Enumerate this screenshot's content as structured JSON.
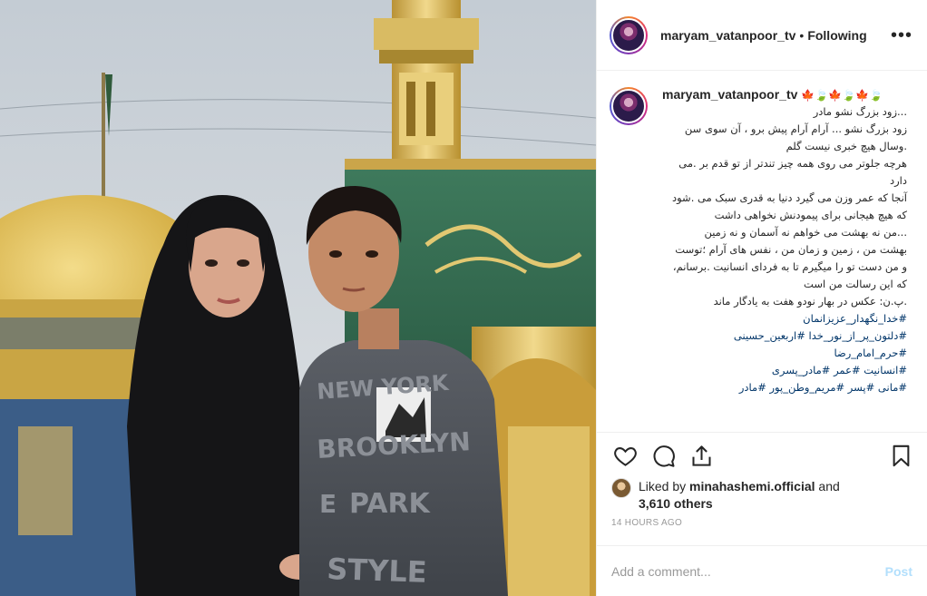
{
  "post": {
    "username": "maryam_vatanpoor_tv",
    "separator": "•",
    "follow_status": "Following",
    "more_glyph": "•••",
    "caption": {
      "username": "maryam_vatanpoor_tv",
      "emoji": "🍁🍃🍁🍃🍁🍃",
      "text": "...زود بزرگ نشو مادر\nزود بزرگ نشو ... آرام آرام پیش برو ، آن سوی سن .وسال هیچ خبری نیست گلم\nهرچه جلوتر می روی همه چیز تندتر از تو قدم بر .می دارد\nآنجا که عمر وزن می گیرد دنیا به قدری سبک می .شود که هیچ هیجانی برای پیمودنش نخواهی داشت\n...من نه بهشت می خواهم نه آسمان و نه زمین\nبهشت من ، زمین و زمان من ، نفس های آرام ؛توست\nو من دست تو را میگیرم تا به فردای انسانیت .برسانم، که این رسالت من است\n.پ.ن: عکس در بهار نودو هفت به یادگار ماند",
      "hashtags": [
        "#خدا_نگهدار_عزیزانمان",
        "#دلتون_پر_از_نور_خدا #اربعین_حسینی",
        "#حرم_امام_رضا",
        "#انسانیت #عمر #مادر_پسری",
        "#مانی #پسر #مریم_وطن_پور #مادر"
      ]
    },
    "likes": {
      "prefix": "Liked by",
      "liker": "minahashemi.official",
      "conjunction": "and",
      "others": "3,610 others"
    },
    "timestamp": "14 HOURS AGO",
    "comment": {
      "placeholder": "Add a comment...",
      "post_label": "Post"
    },
    "photo_text": {
      "shirt_lines": [
        "NEW YORK",
        "BROOKLYN",
        "PARK",
        "STYLE"
      ],
      "shirt_extra": "E"
    }
  },
  "icons": {
    "like": "heart-icon",
    "comment": "comment-bubble-icon",
    "share": "share-icon",
    "save": "bookmark-icon",
    "more": "more-options-icon"
  },
  "colors": {
    "text": "#262626",
    "muted": "#999999",
    "hashtag": "#003569",
    "border": "#efefef",
    "post_disabled": "#b2dffc"
  }
}
